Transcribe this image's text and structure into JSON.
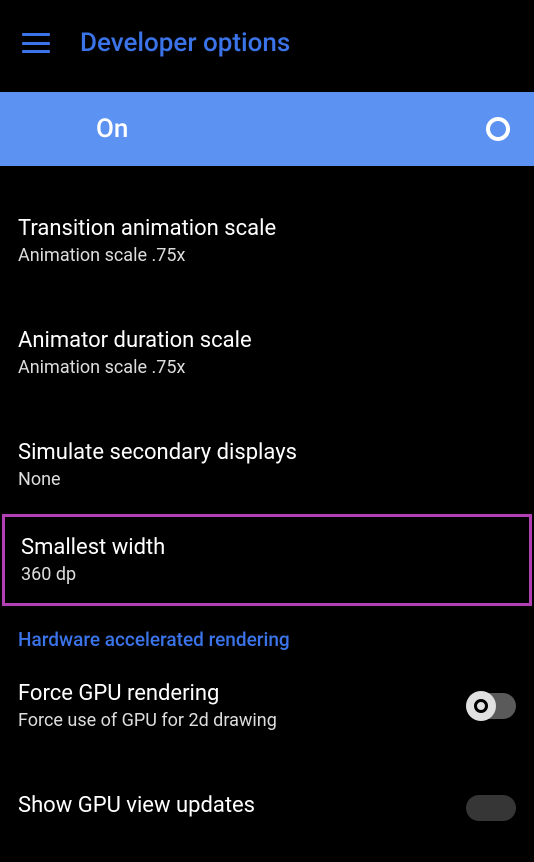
{
  "header": {
    "title": "Developer options"
  },
  "master": {
    "label": "On"
  },
  "items": [
    {
      "title": "Transition animation scale",
      "sub": "Animation scale .75x"
    },
    {
      "title": "Animator duration scale",
      "sub": "Animation scale .75x"
    },
    {
      "title": "Simulate secondary displays",
      "sub": "None"
    },
    {
      "title": "Smallest width",
      "sub": "360 dp"
    }
  ],
  "section": {
    "hardware": "Hardware accelerated rendering"
  },
  "gpu": {
    "force_title": "Force GPU rendering",
    "force_sub": "Force use of GPU for 2d drawing",
    "updates_title": "Show GPU view updates"
  }
}
